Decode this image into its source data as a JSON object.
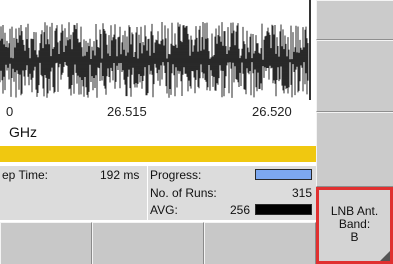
{
  "plot": {
    "ticks": [
      "0",
      "26.515",
      "26.520"
    ],
    "unit": "GHz"
  },
  "info": {
    "sweep_time_label": "ep Time:",
    "sweep_time_value": "192 ms",
    "progress_label": "Progress:",
    "runs_label": "No. of Runs:",
    "runs_value": "315",
    "avg_label": "AVG:",
    "avg_value": "256",
    "progress_fraction": 1.0
  },
  "softkeys": {
    "lnb_line1": "LNB Ant.",
    "lnb_line2": "Band:",
    "lnb_line3": "B"
  },
  "colors": {
    "status_bar": "#f0c810",
    "progress": "#7da8f0",
    "highlight": "#e03030"
  }
}
